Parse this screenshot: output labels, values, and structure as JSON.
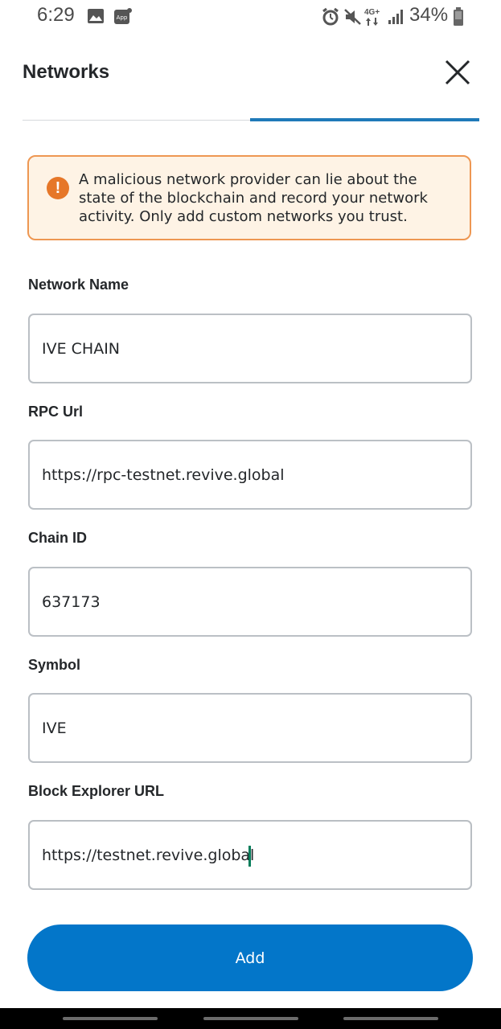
{
  "status_bar": {
    "time": "6:29",
    "battery": "34%",
    "icons": [
      "image-icon",
      "app-notification-icon",
      "alarm-icon",
      "mute-icon",
      "4g-plus-icon",
      "signal-icon",
      "battery-icon"
    ]
  },
  "header": {
    "title": "Networks"
  },
  "warning": {
    "text": "A malicious network provider can lie about the state of the blockchain and record your network activity. Only add custom networks you trust.",
    "icon": "!"
  },
  "form": {
    "network_name": {
      "label": "Network Name",
      "value": "IVE CHAIN"
    },
    "rpc_url": {
      "label": "RPC Url",
      "value": "https://rpc-testnet.revive.global"
    },
    "chain_id": {
      "label": "Chain ID",
      "value": "637173"
    },
    "symbol": {
      "label": "Symbol",
      "value": "IVE"
    },
    "block_explorer_url": {
      "label": "Block Explorer URL",
      "value": "https://testnet.revive.global"
    }
  },
  "actions": {
    "add_label": "Add"
  },
  "colors": {
    "accent": "#0376c9",
    "tab_active": "#1f7ab9",
    "warning_bg": "#fef3e5",
    "warning_border": "#ee9752",
    "warning_icon": "#e67729",
    "caret": "#037d5a"
  }
}
